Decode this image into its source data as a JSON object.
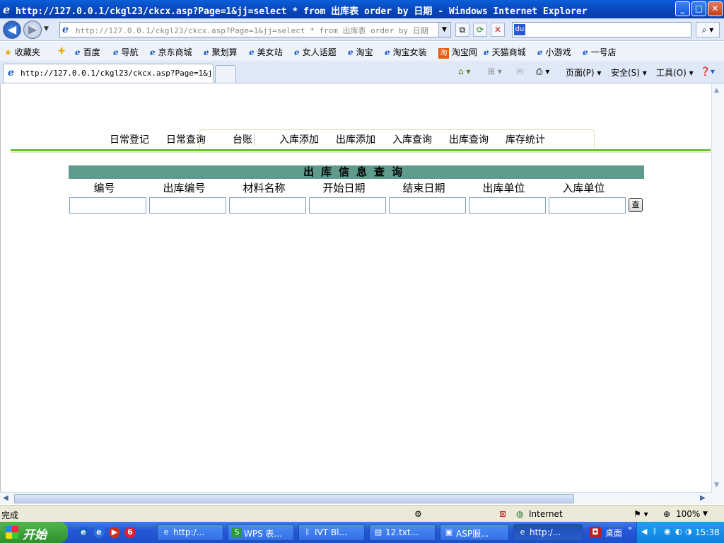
{
  "window": {
    "title": "http://127.0.0.1/ckgl23/ckcx.asp?Page=1&jj=select * from 出库表 order by 日期 - Windows Internet Explorer",
    "minimize": "_",
    "maximize": "□",
    "close": "✕"
  },
  "address_bar": {
    "url": "http://127.0.0.1/ckgl23/ckcx.asp?Page=1&jj=select * from 出库表 order by 日期",
    "search_value": ""
  },
  "favorites": {
    "label": "收藏夹",
    "items": [
      "百度",
      "导航",
      "京东商城",
      "聚划算",
      "美女站",
      "女人话题",
      "淘宝",
      "淘宝女装",
      "淘宝网",
      "天猫商城",
      "小游戏",
      "一号店"
    ]
  },
  "tabs": {
    "active_label": "http://127.0.0.1/ckgl23/ckcx.asp?Page=1&j...",
    "commands": {
      "page": "页面(P)",
      "safety": "安全(S)",
      "tools": "工具(O)"
    }
  },
  "site_menu": {
    "items": [
      "日常登记",
      "日常查询",
      "台账",
      "入库添加",
      "出库添加",
      "入库查询",
      "出库查询",
      "库存统计"
    ]
  },
  "query_form": {
    "title": "出库信息查询",
    "columns": [
      "编号",
      "出库编号",
      "材料名称",
      "开始日期",
      "结束日期",
      "出库单位",
      "入库单位"
    ],
    "values": [
      "",
      "",
      "",
      "",
      "",
      "",
      ""
    ],
    "submit_label": "查"
  },
  "status_bar": {
    "status": "完成",
    "zone": "Internet",
    "zoom": "100%"
  },
  "taskbar": {
    "start": "开始",
    "tasks": [
      "http:/...",
      "WPS 表...",
      "IVT Bl...",
      "12.txt...",
      "ASP服...",
      "http:/..."
    ],
    "desktop": "桌面",
    "clock": "15:38"
  }
}
